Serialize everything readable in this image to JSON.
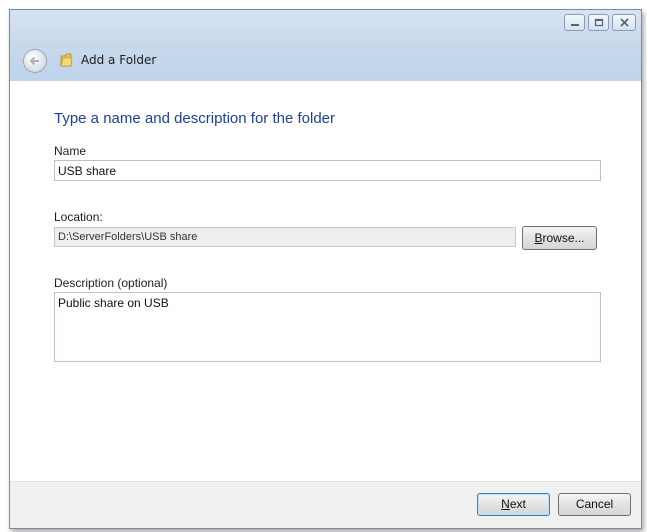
{
  "window": {
    "title": "Add a Folder",
    "caption_buttons": [
      "minimize",
      "maximize",
      "close"
    ]
  },
  "heading": "Type a name and description for the folder",
  "name_field": {
    "label": "Name",
    "value": "USB share"
  },
  "location_field": {
    "label": "Location:",
    "value": "D:\\ServerFolders\\USB share",
    "browse_mnemonic": "B",
    "browse_rest": "rowse..."
  },
  "description_field": {
    "label": "Description (optional)",
    "value": "Public share on USB"
  },
  "footer": {
    "next_mnemonic": "N",
    "next_rest": "ext",
    "cancel_label": "Cancel"
  },
  "icons": {
    "back": "back-arrow-icon",
    "folder": "folder-icon"
  }
}
